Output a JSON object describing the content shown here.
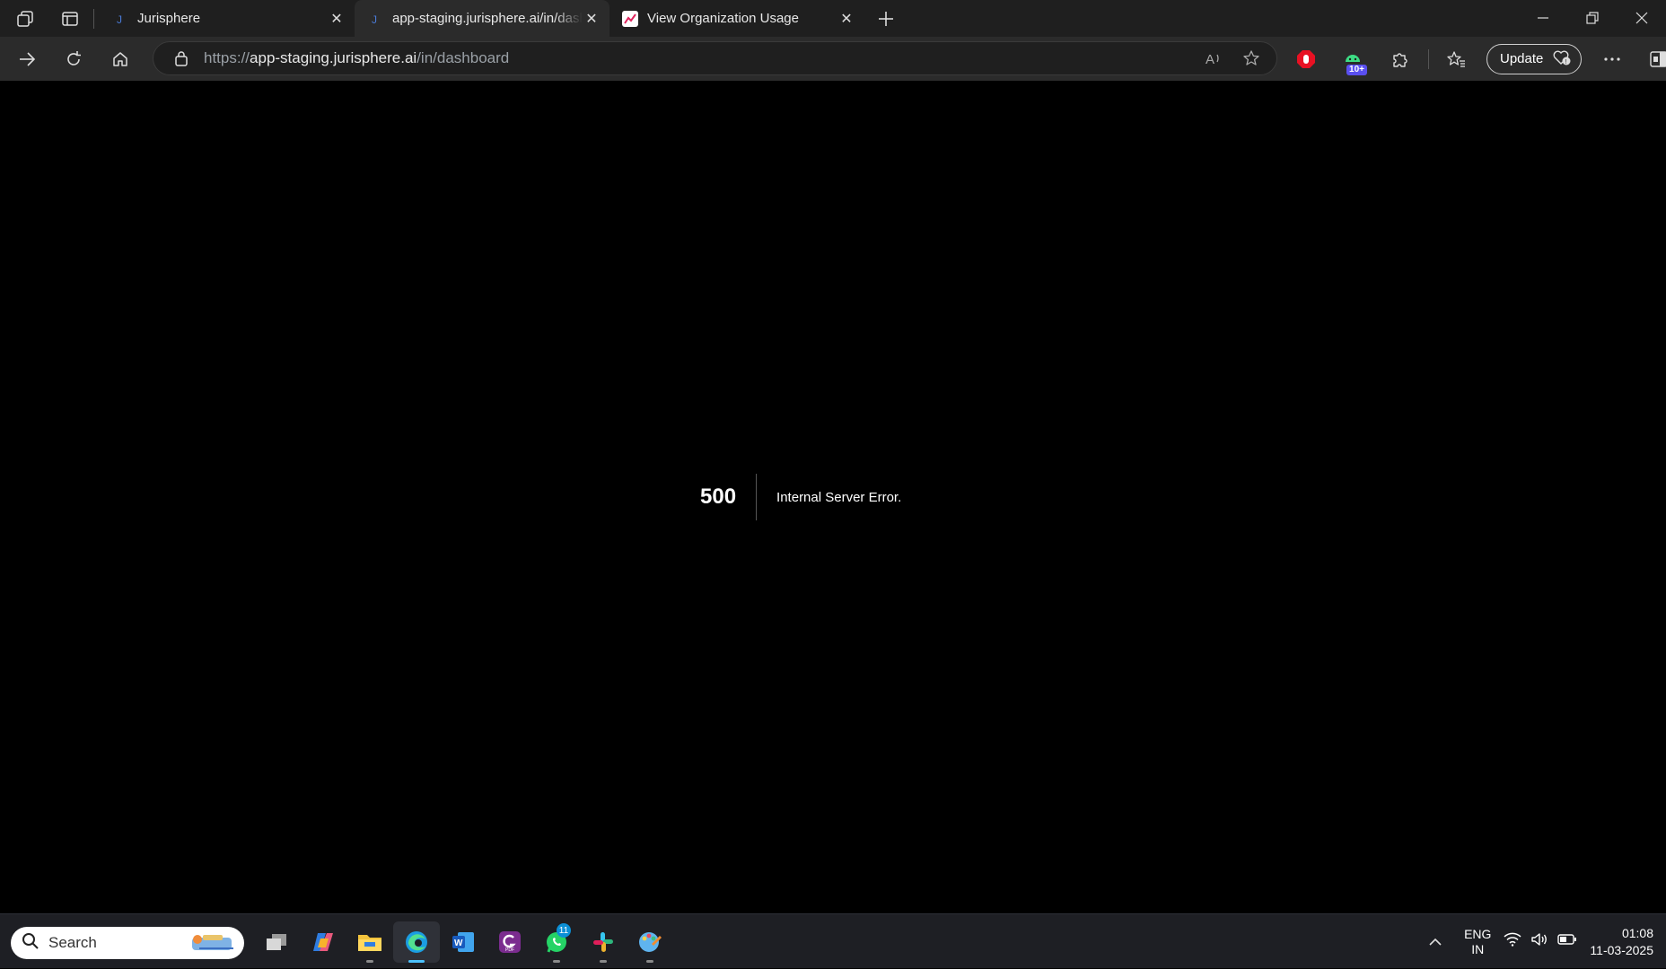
{
  "browser": {
    "tabs": [
      {
        "label": "Jurisphere",
        "active": false
      },
      {
        "label": "app-staging.jurisphere.ai/in/dashboard",
        "active": true
      },
      {
        "label": "View Organization Usage",
        "active": false
      }
    ],
    "address": {
      "scheme": "https://",
      "host": "app-staging.jurisphere.ai",
      "path": "/in/dashboard"
    },
    "update_label": "Update",
    "extension_badge": "10+"
  },
  "error": {
    "code": "500",
    "message": "Internal Server Error."
  },
  "taskbar": {
    "search_label": "Search",
    "whatsapp_badge": "11",
    "language": {
      "line1": "ENG",
      "line2": "IN"
    },
    "time": "01:08",
    "date": "11-03-2025"
  },
  "colors": {
    "tabstrip_bg": "#1f1f1f",
    "toolbar_bg": "#2b2b2b",
    "page_bg": "#000000",
    "taskbar_bg": "#1e1f24",
    "accent": "#4cc2ff"
  }
}
